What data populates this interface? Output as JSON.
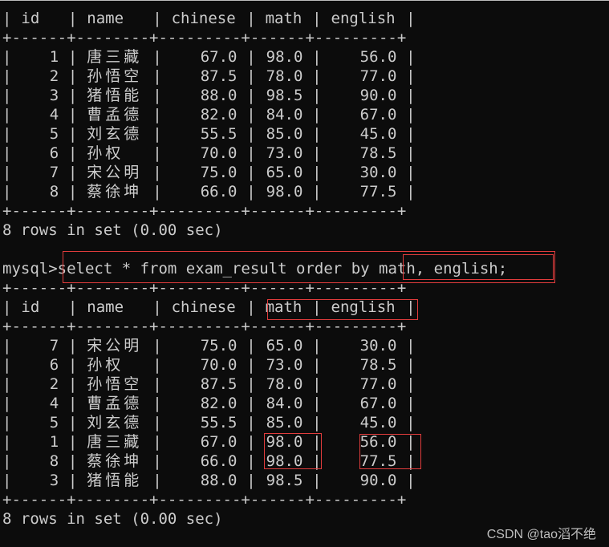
{
  "terminal": {
    "table_columns": [
      "id",
      "name",
      "chinese",
      "math",
      "english"
    ],
    "border_line": "+------+--------+---------+------+---------+",
    "query1": {
      "rows": [
        {
          "id": "1",
          "name": "唐三藏",
          "chinese": "67.0",
          "math": "98.0",
          "english": "56.0"
        },
        {
          "id": "2",
          "name": "孙悟空",
          "chinese": "87.5",
          "math": "78.0",
          "english": "77.0"
        },
        {
          "id": "3",
          "name": "猪悟能",
          "chinese": "88.0",
          "math": "98.5",
          "english": "90.0"
        },
        {
          "id": "4",
          "name": "曹孟德",
          "chinese": "82.0",
          "math": "84.0",
          "english": "67.0"
        },
        {
          "id": "5",
          "name": "刘玄德",
          "chinese": "55.5",
          "math": "85.0",
          "english": "45.0"
        },
        {
          "id": "6",
          "name": "孙权",
          "chinese": "70.0",
          "math": "73.0",
          "english": "78.5"
        },
        {
          "id": "7",
          "name": "宋公明",
          "chinese": "75.0",
          "math": "65.0",
          "english": "30.0"
        },
        {
          "id": "8",
          "name": "蔡徐坤",
          "chinese": "66.0",
          "math": "98.0",
          "english": "77.5"
        }
      ],
      "summary": "8 rows in set (0.00 sec)"
    },
    "prompt": "mysql>",
    "command": "select * from exam_result order by math, english;",
    "query2": {
      "rows": [
        {
          "id": "7",
          "name": "宋公明",
          "chinese": "75.0",
          "math": "65.0",
          "english": "30.0"
        },
        {
          "id": "6",
          "name": "孙权",
          "chinese": "70.0",
          "math": "73.0",
          "english": "78.5"
        },
        {
          "id": "2",
          "name": "孙悟空",
          "chinese": "87.5",
          "math": "78.0",
          "english": "77.0"
        },
        {
          "id": "4",
          "name": "曹孟德",
          "chinese": "82.0",
          "math": "84.0",
          "english": "67.0"
        },
        {
          "id": "5",
          "name": "刘玄德",
          "chinese": "55.5",
          "math": "85.0",
          "english": "45.0"
        },
        {
          "id": "1",
          "name": "唐三藏",
          "chinese": "67.0",
          "math": "98.0",
          "english": "56.0"
        },
        {
          "id": "8",
          "name": "蔡徐坤",
          "chinese": "66.0",
          "math": "98.0",
          "english": "77.5"
        },
        {
          "id": "3",
          "name": "猪悟能",
          "chinese": "88.0",
          "math": "98.5",
          "english": "90.0"
        }
      ],
      "summary": "8 rows in set (0.00 sec)"
    }
  },
  "annotations": {
    "highlight_color": "#e03c3c"
  },
  "watermark": "CSDN @tao滔不绝"
}
